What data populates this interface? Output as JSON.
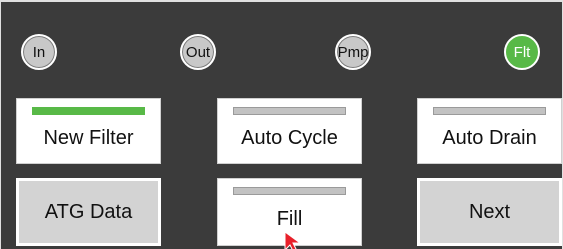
{
  "indicators": [
    {
      "label": "In",
      "active": false
    },
    {
      "label": "Out",
      "active": false
    },
    {
      "label": "Pmp",
      "active": false
    },
    {
      "label": "Flt",
      "active": true
    }
  ],
  "buttons": {
    "new_filter": {
      "label": "New Filter",
      "status_on": true
    },
    "auto_cycle": {
      "label": "Auto Cycle",
      "status_on": false
    },
    "auto_drain": {
      "label": "Auto Drain",
      "status_on": false
    },
    "atg_data": {
      "label": "ATG Data"
    },
    "fill": {
      "label": "Fill",
      "status_on": false
    },
    "next": {
      "label": "Next"
    }
  },
  "colors": {
    "background": "#3b3b3b",
    "active_green": "#58b947",
    "cursor_red": "#e8202a"
  }
}
